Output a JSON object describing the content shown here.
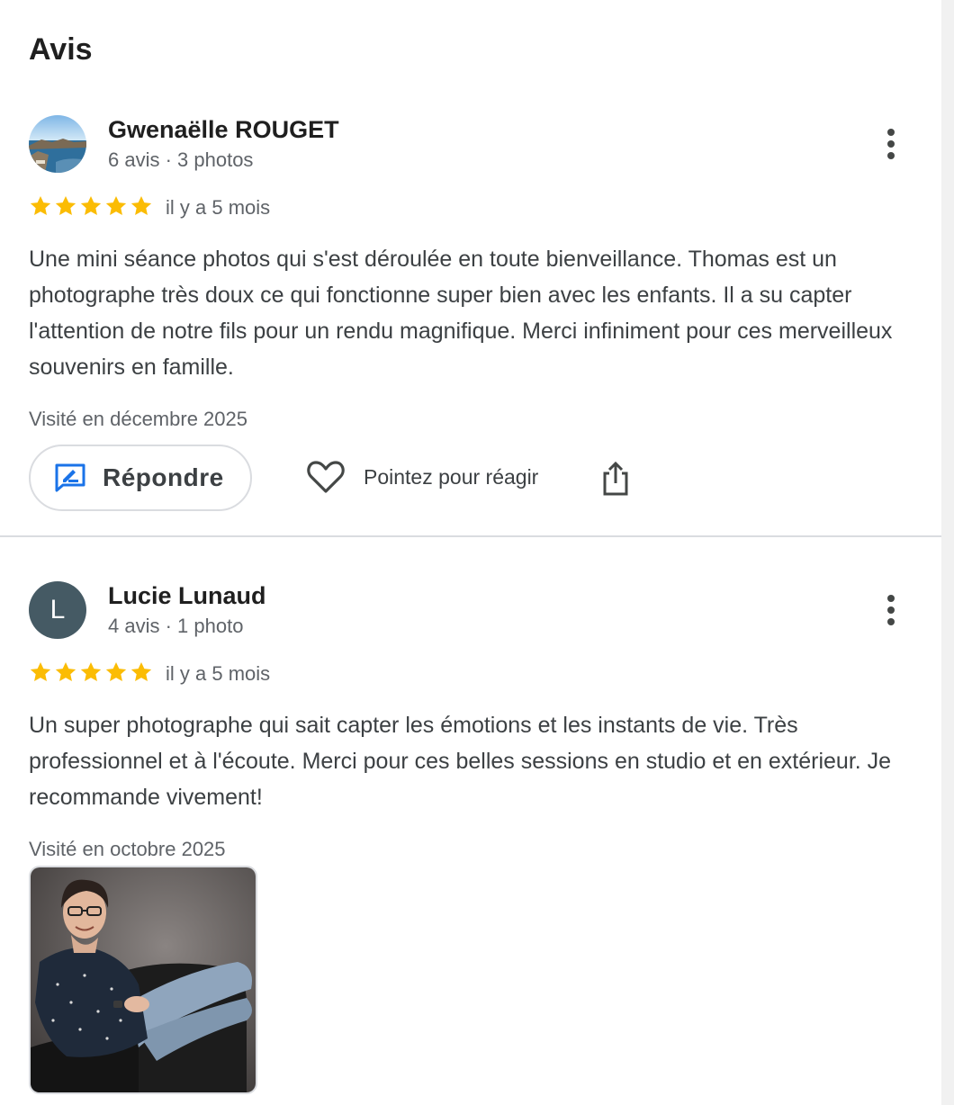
{
  "section": {
    "title": "Avis"
  },
  "reviews": [
    {
      "author": "Gwenaëlle ROUGET",
      "meta": "6 avis · 3 photos",
      "rating": 5,
      "date": "il y a 5 mois",
      "text": "Une mini séance photos qui s'est déroulée en toute bienveillance. Thomas est un photographe très doux ce qui fonctionne super bien avec les enfants. Il a su capter l'attention de notre fils pour un rendu magnifique. Merci infiniment pour ces merveilleux souvenirs en famille.",
      "visited": "Visité en décembre 2025",
      "actions": {
        "reply_label": "Répondre",
        "react_label": "Pointez pour réagir"
      }
    },
    {
      "author": "Lucie Lunaud",
      "avatar_letter": "L",
      "meta": "4 avis · 1 photo",
      "rating": 5,
      "date": "il y a 5 mois",
      "text": "Un super photographe qui sait capter les émotions et les instants de vie. Très professionnel et à l'écoute. Merci pour ces belles sessions en studio et en extérieur. Je recommande vivement!",
      "visited": "Visité en octobre 2025"
    }
  ],
  "colors": {
    "star": "#fbbc04",
    "reply_icon": "#1a73e8",
    "avatar_bg": "#455a64"
  },
  "icons": [
    "more-vert-icon",
    "star-icon",
    "reply-edit-icon",
    "heart-outline-icon",
    "share-icon"
  ]
}
